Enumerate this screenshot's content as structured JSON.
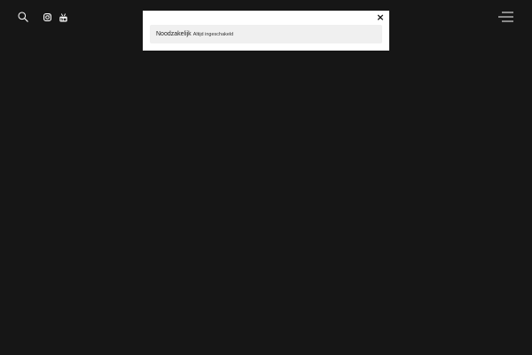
{
  "colors": {
    "background": "#161616",
    "icon": "#ffffff",
    "modal_background": "#ffffff",
    "row_background": "#f0f0f0",
    "text": "#222222"
  },
  "header": {
    "left_icons": [
      "search-icon",
      "instagram-icon",
      "youtube-icon"
    ],
    "right_icon": "hamburger-menu-icon"
  },
  "cookie_modal": {
    "close_label": "×",
    "category": {
      "title": "Noodzakelijk",
      "status": "Altijd ingeschakeld"
    }
  }
}
